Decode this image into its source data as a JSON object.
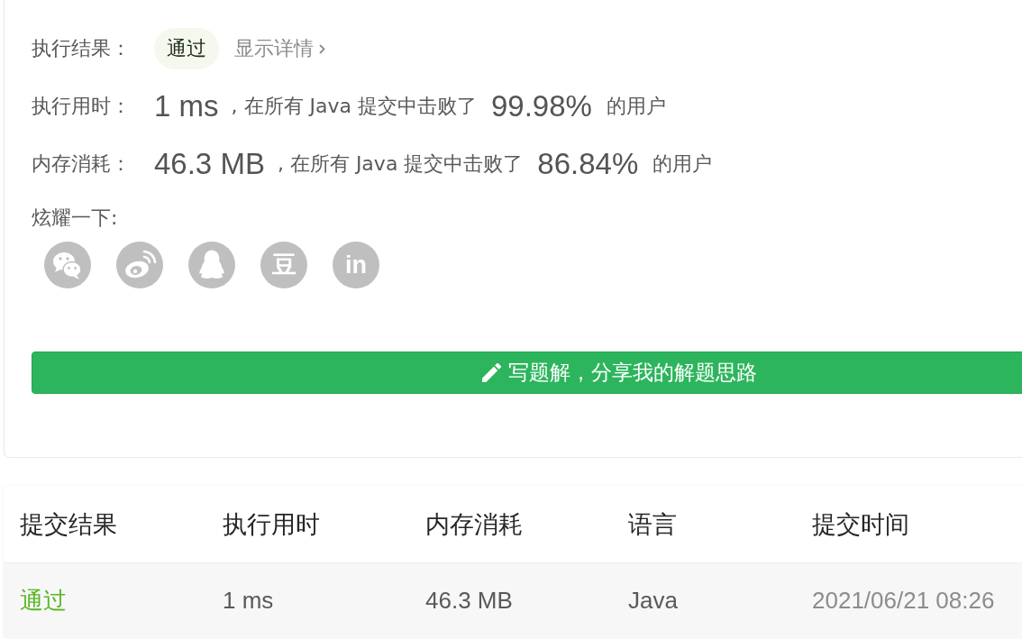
{
  "result": {
    "status_label": "执行结果：",
    "status_badge": "通过",
    "details_link": "显示详情",
    "stats": [
      {
        "label": "执行用时：",
        "value": "1 ms",
        "text": ", 在所有 Java 提交中击败了",
        "percent": "99.98%",
        "suffix": "的用户"
      },
      {
        "label": "内存消耗：",
        "value": "46.3 MB",
        "text": ", 在所有 Java 提交中击败了",
        "percent": "86.84%",
        "suffix": "的用户"
      }
    ],
    "share_label": "炫耀一下:",
    "share_targets": [
      {
        "kind": "bubbles"
      },
      {
        "kind": "eye"
      },
      {
        "kind": "penguin"
      },
      {
        "kind": "glyph",
        "glyph": "豆"
      },
      {
        "kind": "glyph",
        "glyph": "in"
      }
    ],
    "solution_button": "写题解，分享我的解题思路"
  },
  "submissions": {
    "columns": [
      "提交结果",
      "执行用时",
      "内存消耗",
      "语言",
      "提交时间"
    ],
    "rows": [
      {
        "cells": [
          "通过",
          "1 ms",
          "46.3 MB",
          "Java",
          "2021/06/21 08:26"
        ]
      }
    ]
  }
}
